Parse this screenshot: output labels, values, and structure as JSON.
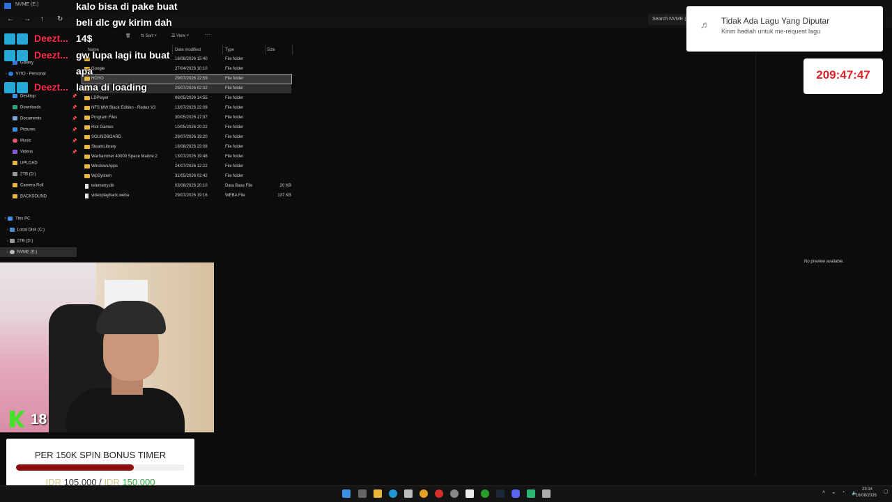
{
  "window": {
    "title": "NVME (E:)"
  },
  "search": {
    "placeholder": "Search NVME (E:)",
    "display": "Search NVME (E:)"
  },
  "toolbar": {
    "sort_label": "Sort",
    "view_label": "View",
    "more": "···"
  },
  "columns": {
    "name": "Name",
    "date": "Date modified",
    "type": "Type",
    "size": "Size"
  },
  "sidebar": {
    "items": [
      {
        "label": "Gallery",
        "icon": "gallery-icon",
        "color": "#3b78d8"
      },
      {
        "label": "VITO - Personal",
        "icon": "cloud-icon",
        "color": "#2f7fe0"
      },
      {
        "label": "Desktop",
        "icon": "desktop-icon",
        "color": "#3b8ee0"
      },
      {
        "label": "Downloads",
        "icon": "download-icon",
        "color": "#2ea27a"
      },
      {
        "label": "Documents",
        "icon": "document-icon",
        "color": "#7aa7d8"
      },
      {
        "label": "Pictures",
        "icon": "picture-icon",
        "color": "#3b8ee0"
      },
      {
        "label": "Music",
        "icon": "music-icon",
        "color": "#e0556a"
      },
      {
        "label": "Videos",
        "icon": "video-icon",
        "color": "#8a5ad8"
      },
      {
        "label": "UPLOAD",
        "icon": "folder-icon",
        "color": "#e8b73a"
      },
      {
        "label": "2TB (D:)",
        "icon": "drive-icon",
        "color": "#999999"
      },
      {
        "label": "Camera Roll",
        "icon": "folder-icon",
        "color": "#e8b73a"
      },
      {
        "label": "BACKSOUND",
        "icon": "folder-icon",
        "color": "#e8b73a"
      }
    ],
    "this_pc": "This PC",
    "drives": [
      "Local Disk (C:)",
      "2TB (D:)",
      "NVME (E:)"
    ]
  },
  "files": [
    {
      "name": "",
      "date": "16/08/2026 15:40",
      "type": "File folder",
      "size": ""
    },
    {
      "name": "Google",
      "date": "27/04/2026 10:10",
      "type": "File folder",
      "size": ""
    },
    {
      "name": "HOYO",
      "date": "29/07/2026 22:59",
      "type": "File folder",
      "size": ""
    },
    {
      "name": "",
      "date": "25/07/2026 02:32",
      "type": "File folder",
      "size": ""
    },
    {
      "name": "LDPlayer",
      "date": "06/05/2026 14:55",
      "type": "File folder",
      "size": ""
    },
    {
      "name": "NFS MW Black Edition - Redux V3",
      "date": "13/07/2026 22:09",
      "type": "File folder",
      "size": ""
    },
    {
      "name": "Program Files",
      "date": "30/05/2026 17:07",
      "type": "File folder",
      "size": ""
    },
    {
      "name": "Riot Games",
      "date": "10/05/2026 20:22",
      "type": "File folder",
      "size": ""
    },
    {
      "name": "SOUNDBOARD",
      "date": "29/07/2026 19:20",
      "type": "File folder",
      "size": ""
    },
    {
      "name": "SteamLibrary",
      "date": "16/08/2026 23:08",
      "type": "File folder",
      "size": ""
    },
    {
      "name": "Warhammer 40000 Space Marine 2",
      "date": "13/07/2026 19:48",
      "type": "File folder",
      "size": ""
    },
    {
      "name": "WindowsApps",
      "date": "24/07/2026 12:22",
      "type": "File folder",
      "size": ""
    },
    {
      "name": "WpSystem",
      "date": "31/05/2026 02:42",
      "type": "File folder",
      "size": ""
    },
    {
      "name": "telemetry.db",
      "date": "03/08/2026 20:10",
      "type": "Data Base File",
      "size": "20 KB"
    },
    {
      "name": "videoplayback.weba",
      "date": "29/07/2026 19:16",
      "type": "WEBA File",
      "size": "137 KB"
    }
  ],
  "preview": {
    "empty": "No preview available."
  },
  "chat": {
    "lines": [
      "kalo bisa di pake buat",
      "beli dlc gw kirim dah",
      "14$",
      "gw lupa lagi itu buat",
      "apa",
      "lama di loading"
    ],
    "users": [
      "Deezt...",
      "Deezt...",
      "Deezt..."
    ]
  },
  "music": {
    "title": "Tidak Ada Lagu Yang Diputar",
    "subtitle": "Kirim hadiah untuk me-request lagu"
  },
  "timer": {
    "value": "209:47:47"
  },
  "webcam": {
    "level": "18"
  },
  "bonus": {
    "title": "PER 150K SPIN BONUS TIMER",
    "currency": "IDR",
    "current": "105.000",
    "separator": "/",
    "goal": "150.000",
    "progress_fraction": 0.7
  },
  "taskbar": {
    "time": "23:14",
    "date": "16/08/2026"
  }
}
